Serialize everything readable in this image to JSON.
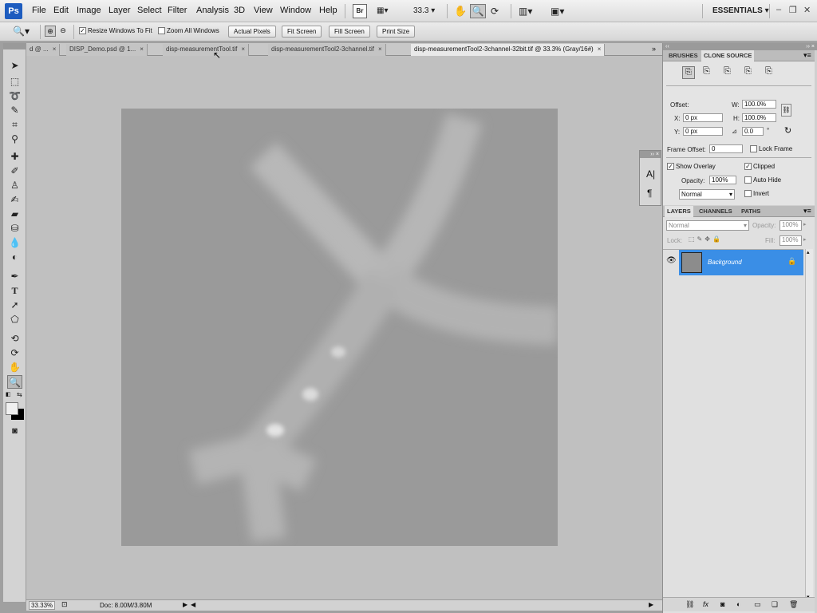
{
  "app": {
    "logo": "Ps"
  },
  "menu": [
    "File",
    "Edit",
    "Image",
    "Layer",
    "Select",
    "Filter",
    "Analysis",
    "3D",
    "View",
    "Window",
    "Help"
  ],
  "appbar": {
    "bridge_label": "Br",
    "zoom_value": "33.3",
    "workspace": "ESSENTIALS"
  },
  "options": {
    "resize_windows_label": "Resize Windows To Fit",
    "zoom_all_label": "Zoom All Windows",
    "actual_pixels": "Actual Pixels",
    "fit_screen": "Fit Screen",
    "fill_screen": "Fill Screen",
    "print_size": "Print Size"
  },
  "tabs": [
    {
      "label": "d @ ...",
      "active": false
    },
    {
      "label": "DISP_Demo.psd @ 1...",
      "active": false
    },
    {
      "label": "disp-measurementTool.tif",
      "active": false
    },
    {
      "label": "disp-measurementTool2-3channel.tif",
      "active": false
    },
    {
      "label": "disp-measurementTool2-3channel-32bit.tif @ 33.3% (Gray/16#)",
      "active": true
    }
  ],
  "status": {
    "zoom": "33.33%",
    "doc": "Doc: 8.00M/3.80M"
  },
  "clone_panel": {
    "tabs": [
      "BRUSHES",
      "CLONE SOURCE"
    ],
    "offset_label": "Offset:",
    "w_label": "W:",
    "w_value": "100.0%",
    "h_label": "H:",
    "h_value": "100.0%",
    "x_label": "X:",
    "x_value": "0 px",
    "y_label": "Y:",
    "y_value": "0 px",
    "angle_value": "0.0",
    "angle_unit": "°",
    "frame_offset_label": "Frame Offset:",
    "frame_offset_value": "0",
    "lock_frame_label": "Lock Frame",
    "show_overlay_label": "Show Overlay",
    "clipped_label": "Clipped",
    "opacity_label": "Opacity:",
    "opacity_value": "100%",
    "auto_hide_label": "Auto Hide",
    "blend_mode": "Normal",
    "invert_label": "Invert"
  },
  "layers_panel": {
    "tabs": [
      "LAYERS",
      "CHANNELS",
      "PATHS"
    ],
    "blend_mode": "Normal",
    "opacity_label": "Opacity:",
    "opacity_value": "100%",
    "lock_label": "Lock:",
    "fill_label": "Fill:",
    "fill_value": "100%",
    "layer_name": "Background"
  }
}
